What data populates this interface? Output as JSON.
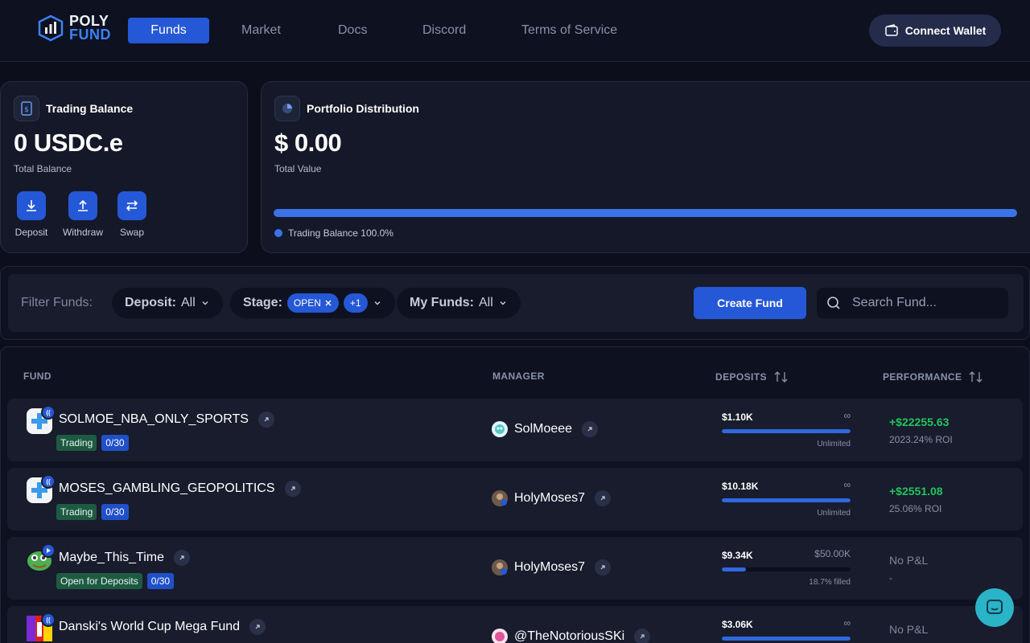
{
  "header": {
    "logo_line1": "POLY",
    "logo_line2": "FUND",
    "nav": [
      "Funds",
      "Market",
      "Docs",
      "Discord",
      "Terms of Service"
    ],
    "active_nav": "Funds",
    "connect_label": "Connect Wallet"
  },
  "trading": {
    "title": "Trading Balance",
    "amount": "0 USDC.e",
    "caption": "Total Balance",
    "actions": [
      "Deposit",
      "Withdraw",
      "Swap"
    ]
  },
  "portfolio": {
    "title": "Portfolio Distribution",
    "amount": "$ 0.00",
    "caption": "Total Value",
    "legend": "Trading Balance 100.0%",
    "trading_fraction": 1.0
  },
  "filters": {
    "label": "Filter Funds:",
    "deposit_label": "Deposit:",
    "deposit_value": "All",
    "stage_label": "Stage:",
    "stage_chip": "OPEN",
    "stage_more": "+1",
    "myfunds_label": "My Funds:",
    "myfunds_value": "All",
    "create_label": "Create Fund",
    "search_placeholder": "Search Fund..."
  },
  "table": {
    "headers": [
      "FUND",
      "MANAGER",
      "DEPOSITS",
      "PERFORMANCE"
    ],
    "rows": [
      {
        "name": "SOLMOE_NBA_ONLY_SPORTS",
        "status": "Trading",
        "slots": "0/30",
        "manager": "SolMoeee",
        "deposits": "$1.10K",
        "cap": "∞",
        "fill_fraction": 1.0,
        "note": "Unlimited",
        "pnl": "+$22255.63",
        "roi": "2023.24% ROI"
      },
      {
        "name": "MOSES_GAMBLING_GEOPOLITICS",
        "status": "Trading",
        "slots": "0/30",
        "manager": "HolyMoses7",
        "deposits": "$10.18K",
        "cap": "∞",
        "fill_fraction": 1.0,
        "note": "Unlimited",
        "pnl": "+$2551.08",
        "roi": "25.06% ROI"
      },
      {
        "name": "Maybe_This_Time",
        "status": "Open for Deposits",
        "slots": "0/30",
        "manager": "HolyMoses7",
        "deposits": "$9.34K",
        "cap": "$50.00K",
        "fill_fraction": 0.187,
        "note": "18.7% filled",
        "pnl": "No P&L",
        "roi": "-"
      },
      {
        "name": "Danski's World Cup Mega Fund",
        "status": "",
        "slots": "",
        "manager": "@TheNotoriousSKi",
        "deposits": "$3.06K",
        "cap": "∞",
        "fill_fraction": 1.0,
        "note": "",
        "pnl": "No P&L",
        "roi": ""
      }
    ]
  },
  "colors": {
    "accent": "#2558d6",
    "positive": "#22c55e",
    "background": "#0c0f1b"
  }
}
